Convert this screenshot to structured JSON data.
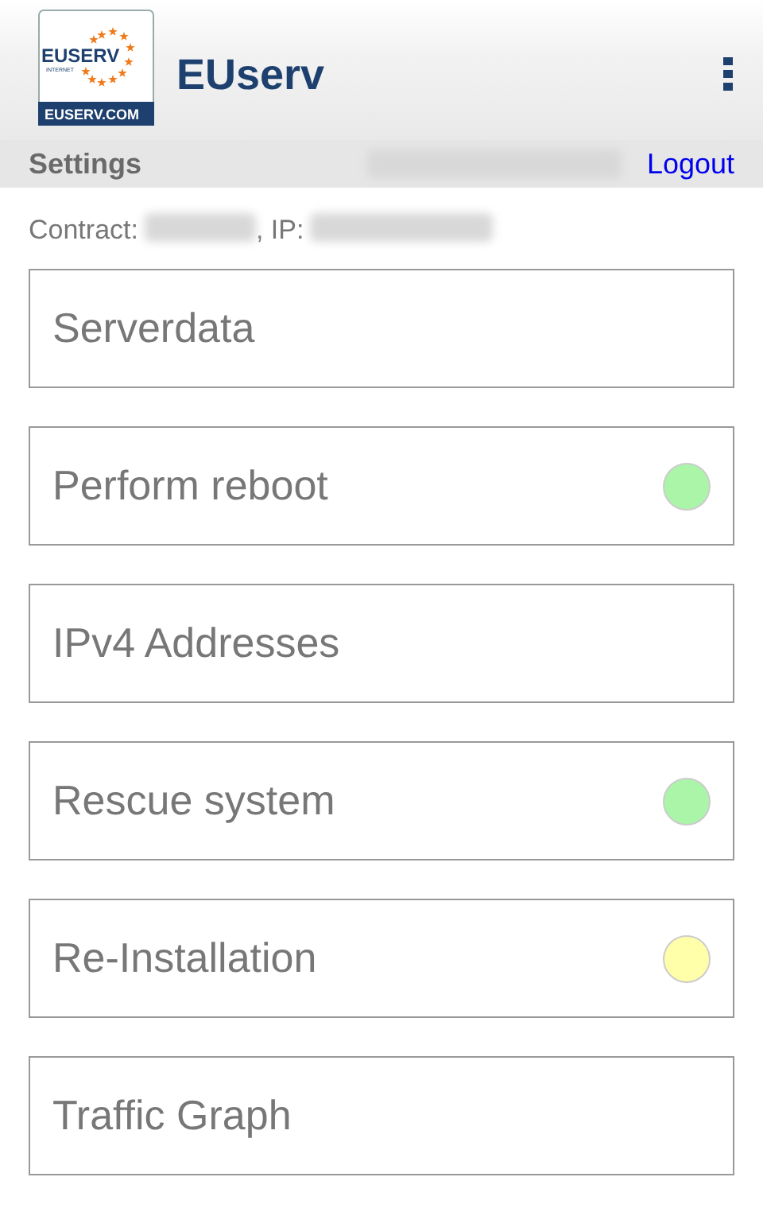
{
  "app_bar": {
    "logo": {
      "wordmark": "EUSERV",
      "tagline": "INTERNET",
      "domain": "EUSERV.COM"
    },
    "title": "EUserv"
  },
  "sub_bar": {
    "settings": "Settings",
    "user_name_redacted": true,
    "logout": "Logout"
  },
  "info_line": [
    {
      "kind": "label",
      "text": "Contract:"
    },
    {
      "kind": "redacted"
    },
    {
      "kind": "label",
      "text": ", IP:"
    },
    {
      "kind": "redacted"
    }
  ],
  "menu": [
    {
      "label": "Serverdata"
    },
    {
      "label": "Perform reboot",
      "color": "#aaf5a8"
    },
    {
      "label": "IPv4 Addresses"
    },
    {
      "label": "Rescue system",
      "color": "#aaf5a8"
    },
    {
      "label": "Re-Installation",
      "color": "#ffffaa"
    },
    {
      "label": "Traffic Graph"
    }
  ]
}
